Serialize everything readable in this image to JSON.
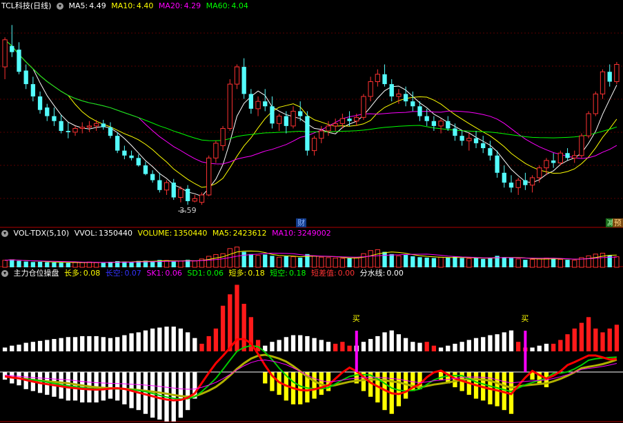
{
  "price_header": {
    "title": "TCL科技(日线)",
    "items": [
      {
        "label": "MA5:",
        "value": "4.49",
        "color": "#ffffff"
      },
      {
        "label": "MA10:",
        "value": "4.40",
        "color": "#ffff00"
      },
      {
        "label": "MA20:",
        "value": "4.29",
        "color": "#ff00ff"
      },
      {
        "label": "MA60:",
        "value": "4.04",
        "color": "#00ff00"
      }
    ]
  },
  "vol_header": {
    "title": "VOL-TDX(5,10)",
    "items": [
      {
        "label": "VVOL:",
        "value": "1350440",
        "color": "#ffffff"
      },
      {
        "label": "VOLUME:",
        "value": "1350440",
        "color": "#ffff00"
      },
      {
        "label": "MA5:",
        "value": "2423612",
        "color": "#ffff00"
      },
      {
        "label": "MA10:",
        "value": "3249002",
        "color": "#ff00ff"
      }
    ]
  },
  "ind_header": {
    "title": "主力仓位操盘",
    "items": [
      {
        "label": "长多:",
        "value": "0.08",
        "color": "#ffff00"
      },
      {
        "label": "长空:",
        "value": "0.07",
        "color": "#3333ff"
      },
      {
        "label": "SK1:",
        "value": "0.06",
        "color": "#ff00ff"
      },
      {
        "label": "SD1:",
        "value": "0.06",
        "color": "#00ff00"
      },
      {
        "label": "短多:",
        "value": "0.18",
        "color": "#ffff00"
      },
      {
        "label": "短空:",
        "value": "0.18",
        "color": "#00ff00"
      },
      {
        "label": "短差值:",
        "value": "0.00",
        "color": "#ff3333"
      },
      {
        "label": "分水线:",
        "value": "0.00",
        "color": "#ffffff"
      }
    ]
  },
  "chart_data": {
    "type": "candlestick",
    "min_price_label": "3.59",
    "event_markers": [
      "财",
      "减",
      "预"
    ],
    "buy_labels": [
      "买",
      "买"
    ],
    "candles": [
      [
        4.38,
        4.62,
        4.28,
        4.6
      ],
      [
        4.55,
        4.72,
        4.46,
        4.5
      ],
      [
        4.52,
        4.58,
        4.32,
        4.34
      ],
      [
        4.35,
        4.4,
        4.2,
        4.24
      ],
      [
        4.24,
        4.3,
        4.1,
        4.14
      ],
      [
        4.14,
        4.18,
        4.0,
        4.03
      ],
      [
        4.05,
        4.08,
        3.94,
        3.98
      ],
      [
        3.98,
        4.05,
        3.9,
        3.94
      ],
      [
        3.94,
        3.99,
        3.84,
        3.86
      ],
      [
        3.86,
        3.93,
        3.8,
        3.85
      ],
      [
        3.85,
        3.9,
        3.82,
        3.88
      ],
      [
        3.88,
        3.93,
        3.84,
        3.89
      ],
      [
        3.89,
        3.94,
        3.85,
        3.9
      ],
      [
        3.9,
        3.95,
        3.86,
        3.92
      ],
      [
        3.92,
        3.95,
        3.87,
        3.89
      ],
      [
        3.89,
        3.93,
        3.8,
        3.82
      ],
      [
        3.82,
        3.85,
        3.68,
        3.7
      ],
      [
        3.7,
        3.74,
        3.63,
        3.66
      ],
      [
        3.66,
        3.7,
        3.62,
        3.64
      ],
      [
        3.64,
        3.67,
        3.57,
        3.58
      ],
      [
        3.58,
        3.61,
        3.5,
        3.51
      ],
      [
        3.51,
        3.54,
        3.44,
        3.46
      ],
      [
        3.46,
        3.52,
        3.36,
        3.38
      ],
      [
        3.38,
        3.46,
        3.34,
        3.44
      ],
      [
        3.44,
        3.47,
        3.3,
        3.32
      ],
      [
        3.32,
        3.41,
        3.28,
        3.39
      ],
      [
        3.39,
        3.42,
        3.26,
        3.29
      ],
      [
        3.29,
        3.34,
        3.28,
        3.31
      ],
      [
        3.28,
        3.36,
        3.26,
        3.34
      ],
      [
        3.34,
        3.66,
        3.33,
        3.64
      ],
      [
        3.64,
        3.78,
        3.6,
        3.76
      ],
      [
        3.74,
        3.9,
        3.7,
        3.88
      ],
      [
        3.88,
        4.28,
        3.86,
        4.24
      ],
      [
        4.24,
        4.4,
        4.2,
        4.38
      ],
      [
        4.38,
        4.45,
        4.12,
        4.16
      ],
      [
        4.16,
        4.2,
        4.0,
        4.04
      ],
      [
        4.04,
        4.14,
        3.98,
        4.1
      ],
      [
        4.1,
        4.2,
        4.02,
        4.06
      ],
      [
        4.06,
        4.14,
        3.88,
        3.92
      ],
      [
        3.92,
        4.0,
        3.86,
        3.98
      ],
      [
        3.98,
        4.02,
        3.84,
        3.9
      ],
      [
        3.9,
        4.06,
        3.88,
        4.02
      ],
      [
        4.02,
        4.1,
        3.94,
        3.98
      ],
      [
        3.98,
        4.02,
        3.66,
        3.7
      ],
      [
        3.7,
        3.82,
        3.66,
        3.8
      ],
      [
        3.8,
        3.9,
        3.76,
        3.86
      ],
      [
        3.86,
        3.94,
        3.82,
        3.9
      ],
      [
        3.9,
        3.96,
        3.86,
        3.92
      ],
      [
        3.92,
        4.0,
        3.88,
        3.96
      ],
      [
        3.96,
        4.02,
        3.9,
        3.94
      ],
      [
        3.94,
        4.0,
        3.9,
        3.97
      ],
      [
        3.97,
        4.16,
        3.95,
        4.14
      ],
      [
        4.14,
        4.3,
        4.1,
        4.26
      ],
      [
        4.26,
        4.36,
        4.22,
        4.32
      ],
      [
        4.32,
        4.4,
        4.22,
        4.24
      ],
      [
        4.24,
        4.28,
        4.1,
        4.14
      ],
      [
        4.14,
        4.2,
        4.08,
        4.16
      ],
      [
        4.16,
        4.22,
        4.06,
        4.1
      ],
      [
        4.1,
        4.18,
        4.02,
        4.06
      ],
      [
        4.06,
        4.1,
        3.94,
        3.98
      ],
      [
        3.98,
        4.04,
        3.9,
        3.94
      ],
      [
        3.94,
        3.98,
        3.86,
        3.9
      ],
      [
        3.9,
        3.96,
        3.84,
        3.94
      ],
      [
        3.94,
        3.98,
        3.86,
        3.88
      ],
      [
        3.88,
        3.92,
        3.78,
        3.82
      ],
      [
        3.82,
        3.86,
        3.74,
        3.78
      ],
      [
        3.78,
        3.84,
        3.7,
        3.8
      ],
      [
        3.8,
        3.86,
        3.72,
        3.76
      ],
      [
        3.76,
        3.82,
        3.68,
        3.72
      ],
      [
        3.72,
        3.78,
        3.62,
        3.66
      ],
      [
        3.66,
        3.7,
        3.48,
        3.52
      ],
      [
        3.52,
        3.58,
        3.4,
        3.44
      ],
      [
        3.44,
        3.5,
        3.36,
        3.4
      ],
      [
        3.4,
        3.48,
        3.34,
        3.46
      ],
      [
        3.46,
        3.52,
        3.38,
        3.42
      ],
      [
        3.42,
        3.5,
        3.36,
        3.48
      ],
      [
        3.48,
        3.58,
        3.44,
        3.56
      ],
      [
        3.56,
        3.64,
        3.5,
        3.62
      ],
      [
        3.62,
        3.68,
        3.56,
        3.6
      ],
      [
        3.6,
        3.7,
        3.58,
        3.68
      ],
      [
        3.68,
        3.72,
        3.62,
        3.64
      ],
      [
        3.64,
        3.7,
        3.6,
        3.66
      ],
      [
        3.66,
        3.84,
        3.64,
        3.82
      ],
      [
        3.82,
        4.02,
        3.8,
        4.0
      ],
      [
        4.0,
        4.18,
        3.98,
        4.16
      ],
      [
        4.16,
        4.36,
        4.12,
        4.34
      ],
      [
        4.34,
        4.4,
        4.22,
        4.26
      ],
      [
        4.26,
        4.42,
        4.24,
        4.4
      ]
    ],
    "volume": [
      3.2,
      3.6,
      2.9,
      2.6,
      2.4,
      2.5,
      2.3,
      2.2,
      2.1,
      2.0,
      2.3,
      2.2,
      2.4,
      2.1,
      2.0,
      2.5,
      2.8,
      2.6,
      2.4,
      2.9,
      3.0,
      2.7,
      3.3,
      3.1,
      2.6,
      2.8,
      3.4,
      2.9,
      3.8,
      5.0,
      5.8,
      6.2,
      8.5,
      9.2,
      7.0,
      6.0,
      5.4,
      5.8,
      5.2,
      4.6,
      5.0,
      4.8,
      4.4,
      6.0,
      5.2,
      4.6,
      4.4,
      4.2,
      4.0,
      4.1,
      4.3,
      6.2,
      7.6,
      8.0,
      7.0,
      6.0,
      5.2,
      5.6,
      5.0,
      4.6,
      4.4,
      4.2,
      4.6,
      4.4,
      4.8,
      4.2,
      4.0,
      4.2,
      3.8,
      4.4,
      5.2,
      4.6,
      4.2,
      3.8,
      3.4,
      3.6,
      3.8,
      4.2,
      4.0,
      3.6,
      3.4,
      3.2,
      4.4,
      5.2,
      6.0,
      6.4,
      5.4,
      4.8
    ],
    "volume_unit": "10^6 shares (approx)",
    "sd1_short_bars": [
      -0.04,
      -0.06,
      -0.07,
      -0.09,
      -0.1,
      -0.11,
      -0.12,
      -0.13,
      -0.14,
      -0.15,
      -0.15,
      -0.16,
      -0.16,
      -0.16,
      -0.15,
      -0.14,
      -0.15,
      -0.17,
      -0.19,
      -0.2,
      -0.22,
      -0.24,
      -0.25,
      -0.26,
      -0.26,
      -0.24,
      -0.2,
      -0.14,
      0.04,
      0.08,
      0.12,
      0.24,
      0.3,
      0.35,
      0.25,
      0.18,
      0.06,
      -0.06,
      -0.1,
      -0.12,
      -0.15,
      -0.17,
      -0.17,
      -0.16,
      -0.14,
      -0.12,
      -0.1,
      0.04,
      0.05,
      0.03,
      -0.06,
      -0.1,
      -0.13,
      -0.16,
      -0.2,
      -0.22,
      -0.18,
      -0.14,
      -0.1,
      -0.09,
      0.05,
      0.03,
      -0.04,
      -0.06,
      -0.08,
      -0.1,
      -0.12,
      -0.14,
      -0.15,
      -0.17,
      -0.18,
      -0.2,
      -0.22,
      0.05,
      0.02,
      -0.04,
      -0.06,
      -0.08,
      0.04,
      0.06,
      0.09,
      0.12,
      0.15,
      0.18,
      0.12,
      0.1,
      0.12,
      0.14
    ],
    "buy_signal_indices": [
      50,
      74
    ]
  }
}
